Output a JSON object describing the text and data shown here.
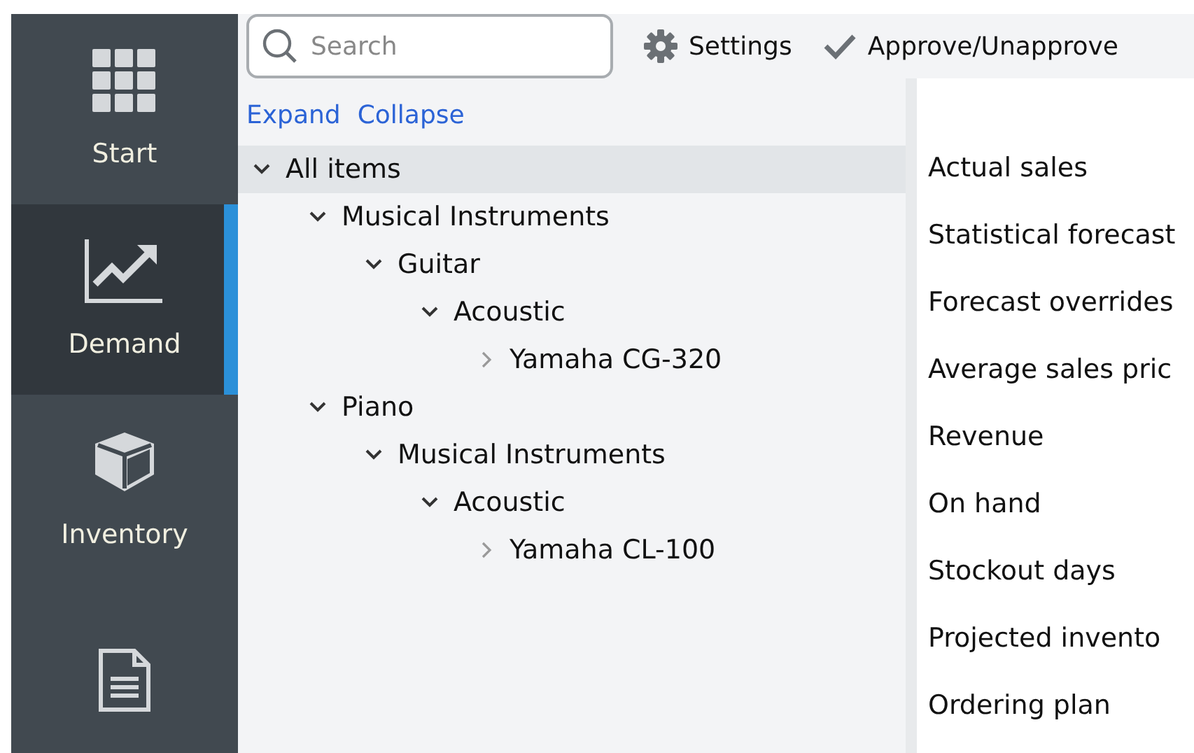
{
  "nav": [
    {
      "label": "Start",
      "kind": "grid",
      "selected": false
    },
    {
      "label": "Demand",
      "kind": "chart",
      "selected": true
    },
    {
      "label": "Inventory",
      "kind": "box",
      "selected": false
    },
    {
      "kind": "doc",
      "selected": false
    }
  ],
  "search": {
    "placeholder": "Search"
  },
  "toolbar": [
    {
      "label": "Settings",
      "kind": "gear"
    },
    {
      "label": "Approve/Unapprove",
      "kind": "check"
    }
  ],
  "tree_links": [
    "Expand",
    "Collapse"
  ],
  "tree": [
    {
      "label": "All items",
      "expanded": true,
      "selected": true,
      "children": [
        {
          "label": "Musical Instruments",
          "expanded": true,
          "selected": false,
          "children": [
            {
              "label": "Guitar",
              "expanded": true,
              "selected": false,
              "children": [
                {
                  "label": "Acoustic",
                  "expanded": true,
                  "selected": false,
                  "children": [
                    {
                      "label": "Yamaha CG-320",
                      "expanded": false,
                      "selected": false
                    }
                  ]
                }
              ]
            }
          ]
        },
        {
          "label": "Piano",
          "expanded": true,
          "selected": false,
          "children": [
            {
              "label": "Musical Instruments",
              "expanded": true,
              "selected": false,
              "children": [
                {
                  "label": "Acoustic",
                  "expanded": true,
                  "selected": false,
                  "children": [
                    {
                      "label": "Yamaha CL-100",
                      "expanded": false,
                      "selected": false
                    }
                  ]
                }
              ]
            }
          ]
        }
      ]
    }
  ],
  "metrics": [
    "Actual sales",
    "Statistical forecast",
    "Forecast overrides",
    "Average sales pric",
    "Revenue",
    "On hand",
    "Stockout days",
    "Projected invento",
    "Ordering plan"
  ]
}
